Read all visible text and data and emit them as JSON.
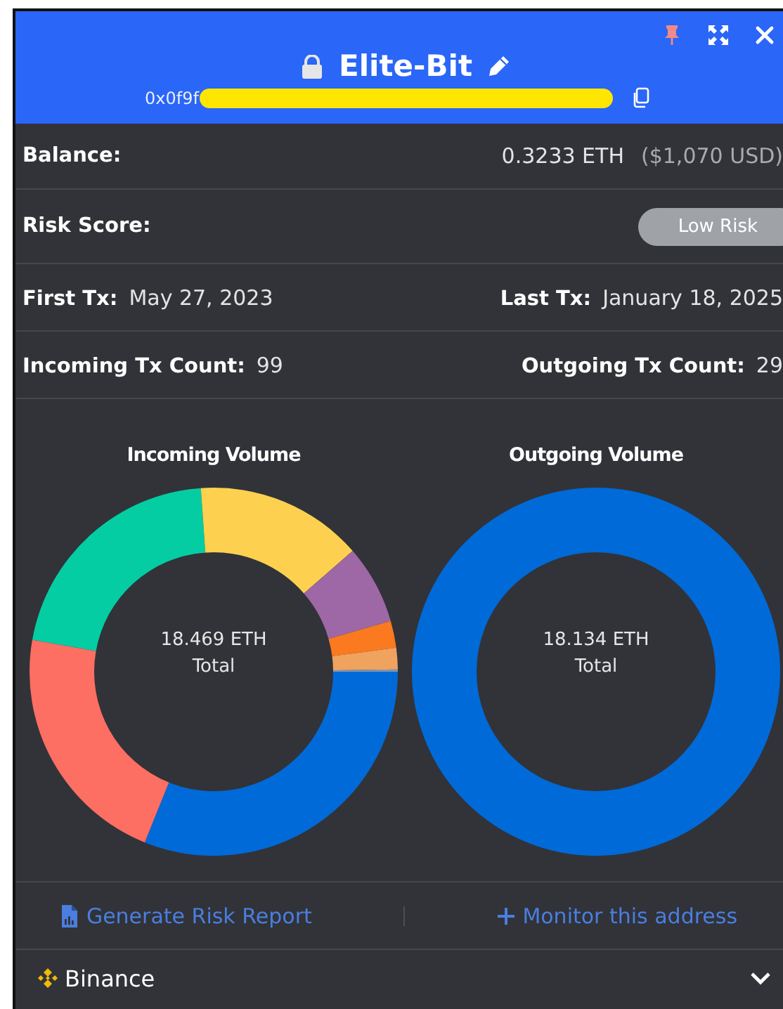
{
  "header": {
    "title": "Elite-Bit",
    "address": "0x0f9f"
  },
  "rows": [
    {
      "kind": "value",
      "label": "Balance:",
      "value": "0.3233 ETH",
      "note": "($1,070 USD)"
    },
    {
      "kind": "badge",
      "label": "Risk Score:",
      "badge": "Low Risk"
    },
    {
      "kind": "pair",
      "left": {
        "label": "First Tx:",
        "value": "May 27, 2023"
      },
      "right": {
        "label": "Last Tx:",
        "value": "January 18, 2025"
      }
    },
    {
      "kind": "pair",
      "left": {
        "label": "Incoming Tx Count:",
        "value": "99"
      },
      "right": {
        "label": "Outgoing Tx Count:",
        "value": "29"
      }
    }
  ],
  "charts": [
    {
      "kind": "multi",
      "title": "Incoming Volume",
      "amount": "18.469 ETH",
      "caption": "Total"
    },
    {
      "kind": "single",
      "title": "Outgoing Volume",
      "amount": "18.134 ETH",
      "caption": "Total"
    }
  ],
  "actions": [
    {
      "kind": "report",
      "label": "Generate Risk Report"
    },
    {
      "kind": "add",
      "label": "Monitor this address"
    }
  ],
  "exchange": {
    "name": "Binance",
    "expanded": false
  }
}
